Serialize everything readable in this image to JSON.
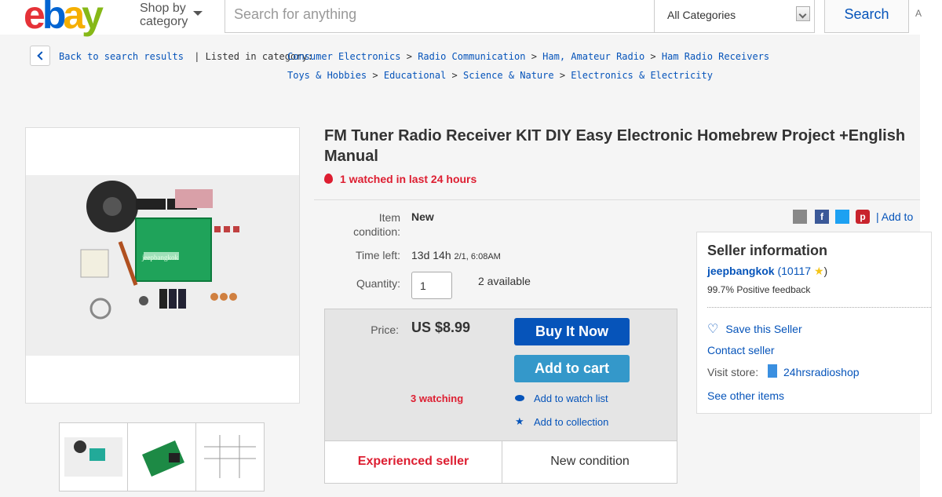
{
  "header": {
    "logo": [
      "e",
      "b",
      "a",
      "y"
    ],
    "shop_by_category": [
      "Shop by",
      "category"
    ],
    "search_placeholder": "Search for anything",
    "category_select": "All Categories",
    "search_button": "Search",
    "advanced_cut": "A"
  },
  "colors": {
    "logo_e": "#e53238",
    "logo_b": "#0064d2",
    "logo_a": "#f5af02",
    "logo_y": "#86b817",
    "link": "#0654ba",
    "alert": "#dd1e31"
  },
  "breadcrumb": {
    "back_label": "Back to search results",
    "listed_in": "| Listed in category:",
    "path1": [
      "Consumer Electronics",
      "Radio Communication",
      "Ham, Amateur Radio",
      "Ham Radio Receivers"
    ],
    "path2": [
      "Toys & Hobbies",
      "Educational",
      "Science & Nature",
      "Electronics & Electricity"
    ]
  },
  "item": {
    "title": "FM Tuner Radio Receiver KIT DIY Easy Electronic Homebrew Project +English Manual",
    "watched_24h": "1 watched in last 24 hours",
    "condition_label": "Item condition:",
    "condition_value": "New",
    "time_left_label": "Time left:",
    "time_left_value": "13d 14h",
    "time_left_end": "2/1, 6:08AM",
    "quantity_label": "Quantity:",
    "quantity_value": "1",
    "available": "2 available",
    "price_label": "Price:",
    "price_value": "US $8.99",
    "buy_now": "Buy It Now",
    "add_to_cart": "Add to cart",
    "watching": "3 watching",
    "add_to_watch": "Add to watch list",
    "add_to_collection": "Add to collection",
    "experienced_seller": "Experienced seller",
    "new_condition": "New condition",
    "photo_watermark": "jeepbangkok"
  },
  "share": {
    "icons": [
      "email-icon",
      "facebook-icon",
      "twitter-icon",
      "pinterest-icon"
    ],
    "add_to": "| Add to"
  },
  "seller": {
    "heading": "Seller information",
    "name": "jeepbangkok",
    "score": "(10117",
    "score_close": ")",
    "feedback": "99.7% Positive feedback",
    "save_seller": "Save this Seller",
    "contact": "Contact seller",
    "visit_store_label": "Visit store:",
    "store_name": "24hrsradioshop",
    "see_other": "See other items"
  }
}
